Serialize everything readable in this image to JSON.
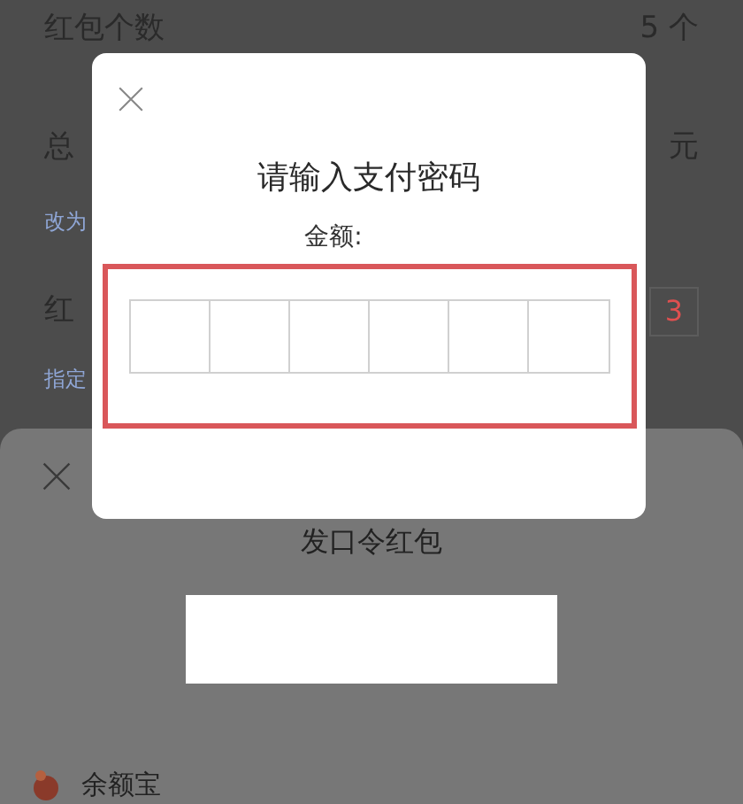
{
  "page": {
    "rows": [
      {
        "kind": "row",
        "label": "红包个数",
        "value": "5 个"
      },
      {
        "kind": "row",
        "label": "总",
        "value": "元"
      },
      {
        "kind": "note",
        "label": "改为"
      },
      {
        "kind": "input",
        "label": "红",
        "value": "3"
      },
      {
        "kind": "note",
        "label": "指定"
      }
    ]
  },
  "sheet": {
    "title": "发口令红包",
    "payment_method": "余额宝"
  },
  "dialog": {
    "title": "请输入支付密码",
    "amount_label": "金额:"
  }
}
